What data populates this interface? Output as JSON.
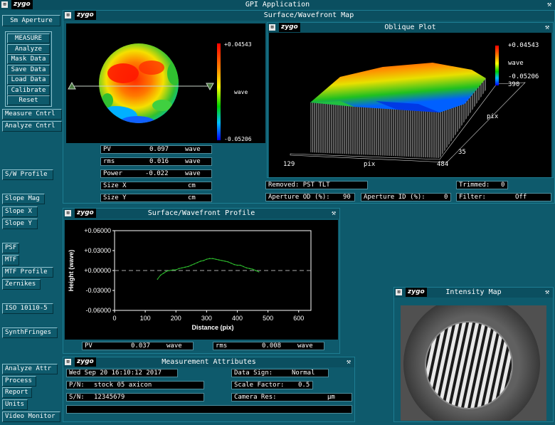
{
  "app": {
    "title": "GPI Application",
    "logo": "zygo"
  },
  "sidebar": {
    "aperture": "Sm Aperture",
    "group_items": [
      "MEASURE",
      "Analyze",
      "Mask Data",
      "Save Data",
      "Load Data",
      "Calibrate",
      "Reset"
    ],
    "items_a": [
      "Measure Cntrl",
      "Analyze Cntrl"
    ],
    "sw_profile": "S/W Profile",
    "items_b": [
      "Slope Mag",
      "Slope X",
      "Slope Y"
    ],
    "items_c": [
      "PSF",
      "MTF",
      "MTF Profile",
      "Zernikes"
    ],
    "iso": "ISO 10110-5",
    "synth": "SynthFringes",
    "items_d": [
      "Analyze Attr",
      "Process",
      "Report",
      "Units",
      "Video Monitor"
    ]
  },
  "surface_map": {
    "title": "Surface/Wavefront Map",
    "scale_max": "+0.04543",
    "scale_unit": "wave",
    "scale_min": "-0.05206",
    "results": [
      {
        "label": "PV",
        "value": "0.097",
        "unit": "wave"
      },
      {
        "label": "rms",
        "value": "0.016",
        "unit": "wave"
      },
      {
        "label": "Power",
        "value": "-0.022",
        "unit": "wave"
      },
      {
        "label": "Size X",
        "value": "",
        "unit": "cm"
      },
      {
        "label": "Size Y",
        "value": "",
        "unit": "cm"
      }
    ]
  },
  "oblique": {
    "title": "Oblique Plot",
    "scale_max": "+0.04543",
    "scale_unit": "wave",
    "scale_min": "-0.05206",
    "y_top": "390",
    "y_label": "pix",
    "y_bottom": "35",
    "x_left": "129",
    "x_label": "pix",
    "x_right": "484"
  },
  "status": {
    "removed": "Removed: PST TLT",
    "trimmed_label": "Trimmed:",
    "trimmed_value": "0",
    "ap_od_label": "Aperture OD (%):",
    "ap_od_value": "90",
    "ap_id_label": "Aperture ID (%):",
    "ap_id_value": "0",
    "filter_label": "Filter:",
    "filter_value": "Off"
  },
  "profile": {
    "title": "Surface/Wavefront Profile",
    "pv_label": "PV",
    "pv_value": "0.037",
    "pv_unit": "wave",
    "rms_label": "rms",
    "rms_value": "0.008",
    "rms_unit": "wave"
  },
  "chart_data": {
    "type": "line",
    "title": "",
    "xlabel": "Distance (pix)",
    "ylabel": "Height (wave)",
    "xlim": [
      0,
      640
    ],
    "ylim": [
      -0.06,
      0.06
    ],
    "x_ticks": [
      0,
      100,
      200,
      300,
      400,
      500,
      600
    ],
    "y_ticks": [
      "+0.06000",
      "+0.03000",
      "+0.00000",
      "-0.03000",
      "-0.06000"
    ],
    "y_tick_values": [
      0.06,
      0.03,
      0.0,
      -0.03,
      -0.06
    ],
    "grid": false,
    "series": [
      {
        "x": [
          140,
          150,
          160,
          170,
          180,
          190,
          200,
          210,
          220,
          230,
          240,
          250,
          260,
          270,
          280,
          290,
          300,
          310,
          320,
          330,
          340,
          350,
          360,
          370,
          380,
          390,
          400,
          410,
          420,
          430,
          440,
          450,
          460,
          470
        ],
        "values": [
          -0.013,
          -0.007,
          -0.004,
          -0.001,
          0.0,
          0.001,
          0.001,
          0.003,
          0.004,
          0.005,
          0.006,
          0.008,
          0.01,
          0.012,
          0.014,
          0.015,
          0.017,
          0.018,
          0.018,
          0.017,
          0.016,
          0.015,
          0.014,
          0.013,
          0.011,
          0.009,
          0.008,
          0.008,
          0.006,
          0.004,
          0.003,
          0.002,
          0.0,
          -0.002
        ]
      }
    ]
  },
  "intensity": {
    "title": "Intensity Map"
  },
  "attributes": {
    "title": "Measurement Attributes",
    "date": "Wed Sep 20 16:10:12 2017",
    "pn_label": "P/N:",
    "pn_value": "stock 05 axicon",
    "sn_label": "S/N:",
    "sn_value": "12345679",
    "data_sign_label": "Data Sign:",
    "data_sign_value": "Normal",
    "scale_factor_label": "Scale Factor:",
    "scale_factor_value": "0.5",
    "camera_res_label": "Camera Res:",
    "camera_res_unit": "µm"
  }
}
